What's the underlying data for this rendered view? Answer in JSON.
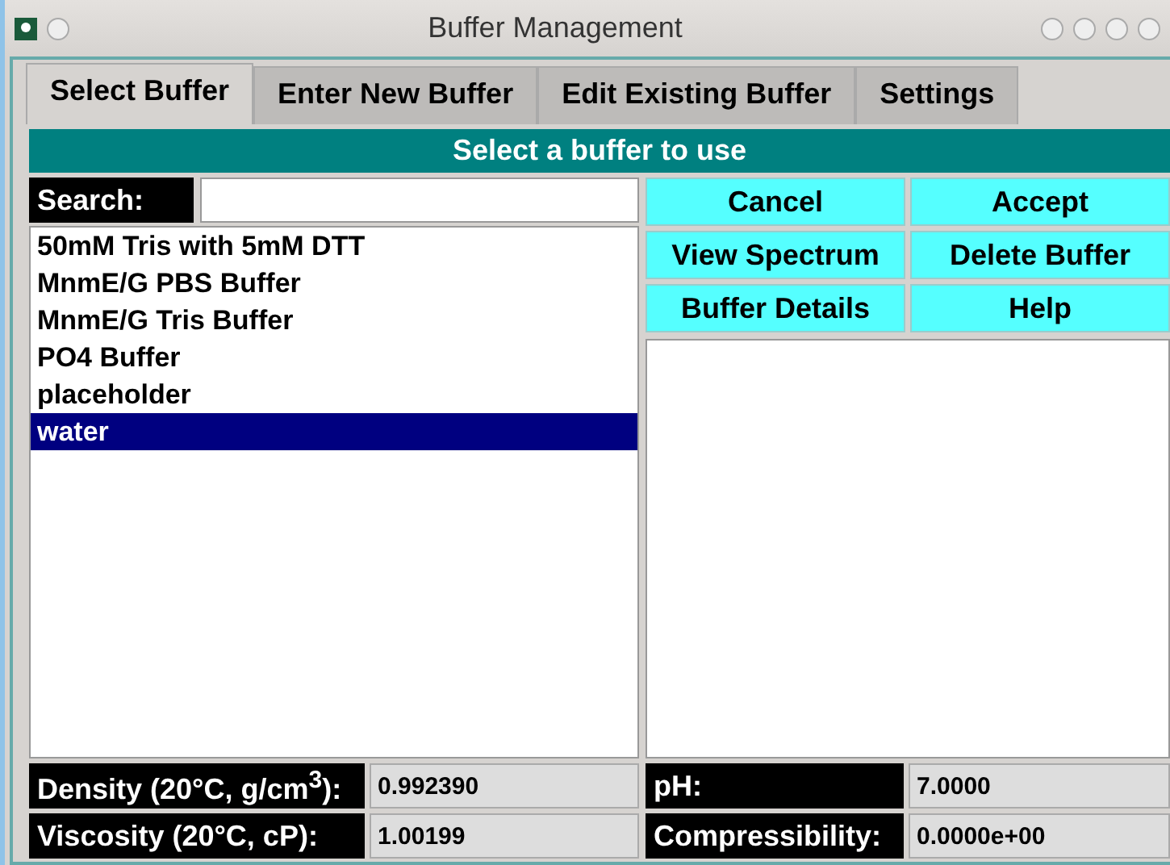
{
  "window": {
    "title": "Buffer Management"
  },
  "tabs": [
    {
      "label": "Select Buffer",
      "selected": true
    },
    {
      "label": "Enter New Buffer",
      "selected": false
    },
    {
      "label": "Edit Existing Buffer",
      "selected": false
    },
    {
      "label": "Settings",
      "selected": false
    }
  ],
  "banner": "Select a buffer to use",
  "search": {
    "label": "Search:"
  },
  "buffers": [
    {
      "name": "50mM Tris with 5mM DTT",
      "selected": false
    },
    {
      "name": "MnmE/G PBS Buffer",
      "selected": false
    },
    {
      "name": "MnmE/G Tris Buffer",
      "selected": false
    },
    {
      "name": "PO4 Buffer",
      "selected": false
    },
    {
      "name": "placeholder",
      "selected": false
    },
    {
      "name": "water",
      "selected": true
    }
  ],
  "buttons": [
    "Cancel",
    "Accept",
    "View Spectrum",
    "Delete Buffer",
    "Buffer Details",
    "Help"
  ],
  "properties": [
    {
      "label": "Density (20°C, g/cm$^{3}$):",
      "value": "0.992390"
    },
    {
      "label": "pH:",
      "value": "7.0000"
    },
    {
      "label": "Viscosity (20°C, cP):",
      "value": "1.00199"
    },
    {
      "label": "Compressibility:",
      "value": "0.0000e+00"
    }
  ]
}
